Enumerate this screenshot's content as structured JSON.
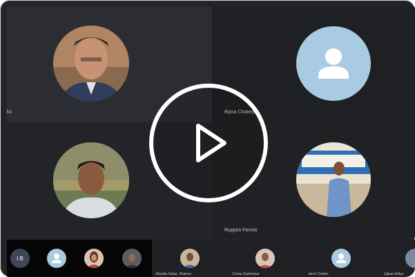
{
  "participants": {
    "p1": {
      "name": "ks",
      "photo_icon": "man-portrait-photo"
    },
    "p2": {
      "name": "Bipsa Chaterjee",
      "avatar_icon": "default-user-avatar-icon"
    },
    "p3": {
      "name": "",
      "photo_icon": "man-portrait-photo"
    },
    "p4": {
      "name": "Rupjoto Ferces",
      "photo_icon": "man-presenting-photo"
    }
  },
  "strip": {
    "initials": "I B",
    "items": [
      {
        "name": "Manika Sahar, Sharma"
      },
      {
        "name": "Contur Kashrnaut"
      },
      {
        "name": "Jarch Chafes"
      },
      {
        "name": "Ujjwai Aditya"
      }
    ]
  },
  "controls": {
    "play_icon": "play-icon"
  },
  "colors": {
    "tile_dark": "#232427",
    "avatar_blue": "#a8cbe3",
    "play_ring": "#ffffff"
  }
}
